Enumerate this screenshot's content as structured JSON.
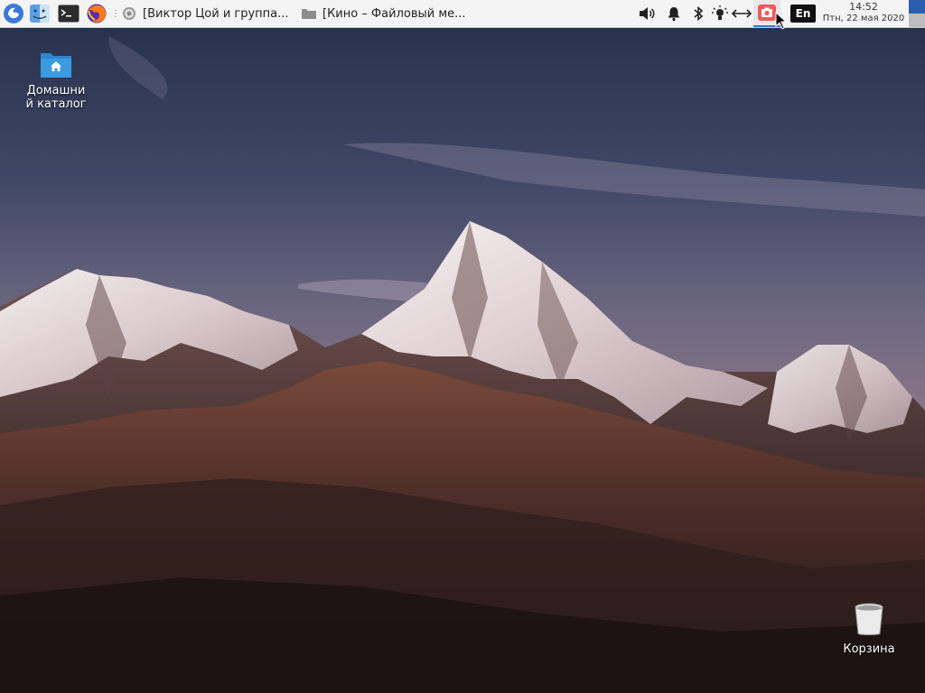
{
  "panel": {
    "launchers": [
      {
        "name": "app-menu",
        "icon": "distro-menu-icon"
      },
      {
        "name": "file-manager",
        "icon": "finder-face-icon"
      },
      {
        "name": "terminal",
        "icon": "terminal-icon"
      },
      {
        "name": "firefox",
        "icon": "firefox-icon"
      }
    ],
    "tasks": [
      {
        "icon": "browser-globe-icon",
        "title": "[Виктор Цой и группа..."
      },
      {
        "icon": "folder-icon",
        "title": "[Кино – Файловый ме..."
      }
    ],
    "tray": [
      "volume-icon",
      "notification-bell-icon",
      "bluetooth-icon",
      "brightness-icon",
      "network-arrows-icon",
      "screenshot-camera-icon"
    ],
    "keyboard_layout": "En",
    "clock": {
      "time": "14:52",
      "date": "Птн, 22 мая 2020"
    }
  },
  "desktop": {
    "icons": [
      {
        "label": "Домашний каталог",
        "label_line1": "Домашни",
        "label_line2": "й каталог",
        "icon": "home-folder-icon"
      },
      {
        "label": "Корзина",
        "icon": "trash-icon"
      }
    ]
  },
  "colors": {
    "panel_bg": "#f4f4f4",
    "accent": "#2f7bd6",
    "folder_blue": "#3a9be0"
  }
}
